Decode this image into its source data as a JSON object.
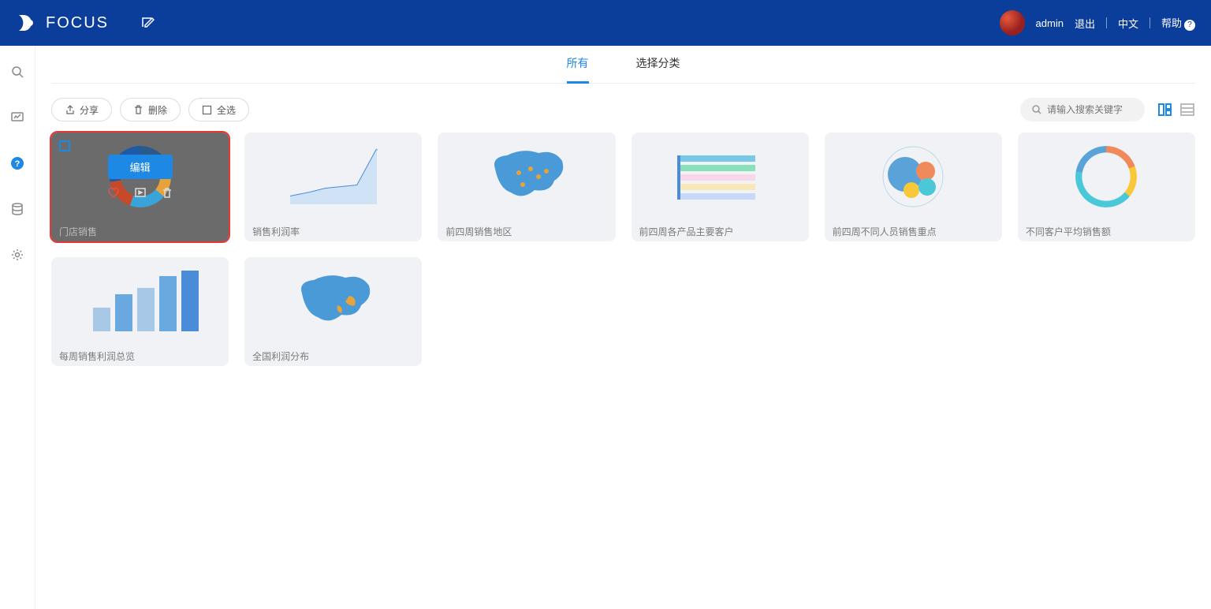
{
  "header": {
    "brand": "FOCUS",
    "user": "admin",
    "logout": "退出",
    "language": "中文",
    "help": "帮助"
  },
  "tabs": {
    "all": "所有",
    "category": "选择分类"
  },
  "toolbar": {
    "share": "分享",
    "delete": "删除",
    "select_all": "全选",
    "search_placeholder": "请输入搜索关键字"
  },
  "overlay": {
    "edit": "编辑"
  },
  "cards": [
    {
      "title": "门店销售"
    },
    {
      "title": "销售利润率"
    },
    {
      "title": "前四周销售地区"
    },
    {
      "title": "前四周各产品主要客户"
    },
    {
      "title": "前四周不同人员销售重点"
    },
    {
      "title": "不同客户平均销售额"
    },
    {
      "title": "每周销售利润总览"
    },
    {
      "title": "全国利润分布"
    }
  ]
}
